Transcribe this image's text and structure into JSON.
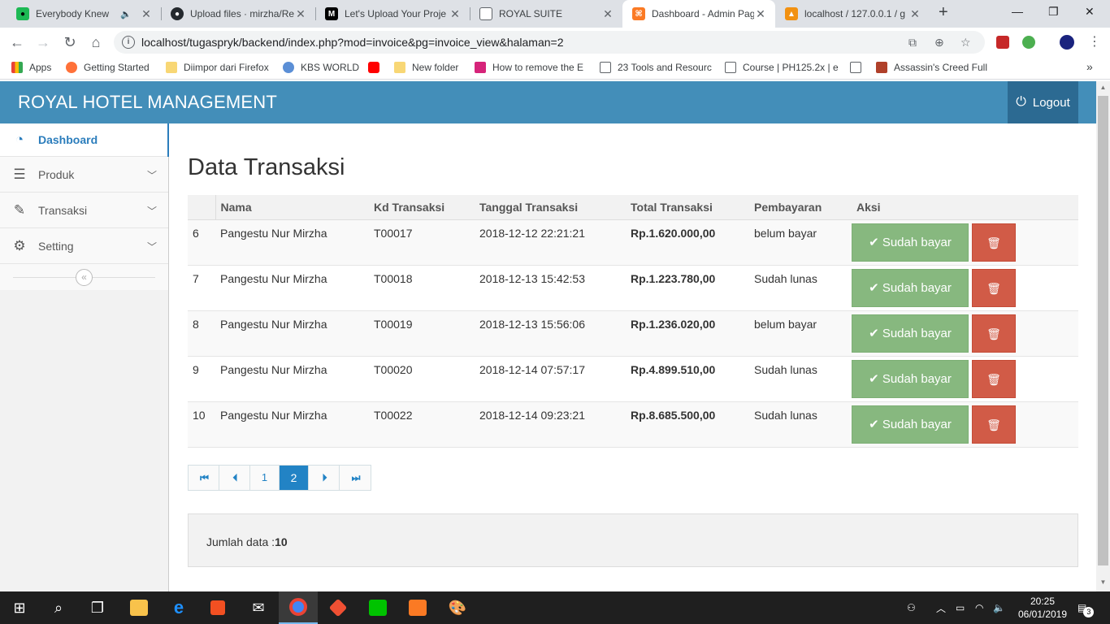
{
  "browser": {
    "tabs": [
      {
        "title": "Everybody Knew",
        "favicon_color": "#1db954",
        "audio": true
      },
      {
        "title": "Upload files · mirzha/Re",
        "favicon_color": "#24292e"
      },
      {
        "title": "Let's Upload Your Proje",
        "favicon_color": "#000000",
        "favicon_text": "M"
      },
      {
        "title": "ROYAL SUITE",
        "favicon_color": "#ffffff"
      },
      {
        "title": "Dashboard - Admin Pag",
        "favicon_color": "#fb7a24",
        "active": true
      },
      {
        "title": "localhost / 127.0.0.1 / g",
        "favicon_color": "#f29111"
      }
    ],
    "new_tab_label": "+",
    "url": "localhost/tugaspryk/backend/index.php?mod=invoice&pg=invoice_view&halaman=2",
    "bookmarks": [
      {
        "label": "Apps",
        "icon_color": "#ea4335"
      },
      {
        "label": "Getting Started",
        "icon_color": "#ff7139"
      },
      {
        "label": "Diimpor dari Firefox",
        "icon_color": "#f8d775"
      },
      {
        "label": "KBS WORLD",
        "icon_color": "#5b8fd6"
      },
      {
        "label": "",
        "icon_color": "#ff0000"
      },
      {
        "label": "New folder",
        "icon_color": "#f8d775"
      },
      {
        "label": "How to remove the E",
        "icon_color": "#d6247a"
      },
      {
        "label": "23 Tools and Resourc",
        "icon_color": "#ffffff"
      },
      {
        "label": "Course | PH125.2x | e",
        "icon_color": "#ffffff"
      },
      {
        "label": "",
        "icon_color": "#ffffff"
      },
      {
        "label": "Assassin's Creed Full",
        "icon_color": "#b0402a"
      }
    ],
    "more_bookmarks": "»"
  },
  "app": {
    "brand": "ROYAL HOTEL MANAGEMENT",
    "logout_label": "Logout",
    "accent_color": "#438eb9",
    "sidebar": [
      {
        "label": "Dashboard",
        "icon": "dashboard-icon",
        "active": true
      },
      {
        "label": "Produk",
        "icon": "list-icon"
      },
      {
        "label": "Transaksi",
        "icon": "pencil-icon"
      },
      {
        "label": "Setting",
        "icon": "gear-icon"
      }
    ],
    "collapse_label": "«"
  },
  "main": {
    "title": "Data Transaksi",
    "columns": [
      "",
      "Nama",
      "Kd Transaksi",
      "Tanggal Transaksi",
      "Total Transaksi",
      "Pembayaran",
      "Aksi"
    ],
    "rows": [
      {
        "no": "6",
        "nama": "Pangestu Nur Mirzha",
        "kd": "T00017",
        "tanggal": "2018-12-12 22:21:21",
        "total": "Rp.1.620.000,00",
        "pembayaran": "belum bayar"
      },
      {
        "no": "7",
        "nama": "Pangestu Nur Mirzha",
        "kd": "T00018",
        "tanggal": "2018-12-13 15:42:53",
        "total": "Rp.1.223.780,00",
        "pembayaran": "Sudah lunas"
      },
      {
        "no": "8",
        "nama": "Pangestu Nur Mirzha",
        "kd": "T00019",
        "tanggal": "2018-12-13 15:56:06",
        "total": "Rp.1.236.020,00",
        "pembayaran": "belum bayar"
      },
      {
        "no": "9",
        "nama": "Pangestu Nur Mirzha",
        "kd": "T00020",
        "tanggal": "2018-12-14 07:57:17",
        "total": "Rp.4.899.510,00",
        "pembayaran": "Sudah lunas"
      },
      {
        "no": "10",
        "nama": "Pangestu Nur Mirzha",
        "kd": "T00022",
        "tanggal": "2018-12-14 09:23:21",
        "total": "Rp.8.685.500,00",
        "pembayaran": "Sudah lunas"
      }
    ],
    "paid_button_label": "Sudah bayar",
    "pagination": {
      "first": "⏮",
      "prev": "⏴",
      "pages": [
        "1",
        "2"
      ],
      "current": "2",
      "next": "⏵",
      "last": "⏭"
    },
    "footer_label": "Jumlah data :",
    "footer_count": "10"
  },
  "taskbar": {
    "time": "20:25",
    "date": "06/01/2019",
    "notification_count": "3"
  }
}
